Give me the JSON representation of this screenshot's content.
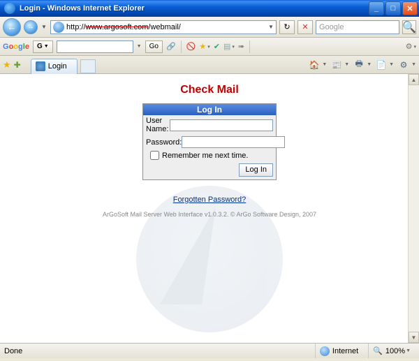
{
  "window": {
    "title": "Login - Windows Internet Explorer"
  },
  "nav": {
    "url_prefix": "http://",
    "url_struck": "www.argosoft.com",
    "url_suffix": "/webmail/",
    "search_placeholder": "Google"
  },
  "gbar": {
    "go_label": "Go"
  },
  "tabs": {
    "active": "Login"
  },
  "page": {
    "heading": "Check Mail",
    "login_header": "Log In",
    "username_label": "User Name:",
    "password_label": "Password:",
    "remember_label": "Remember me next time.",
    "login_btn": "Log In",
    "forgot": "Forgotten Password?",
    "footer": "ArGoSoft Mail Server Web Interface v1.0.3.2.   © ArGo Software Design, 2007"
  },
  "status": {
    "done": "Done",
    "internet": "Internet",
    "zoom": "100%"
  }
}
